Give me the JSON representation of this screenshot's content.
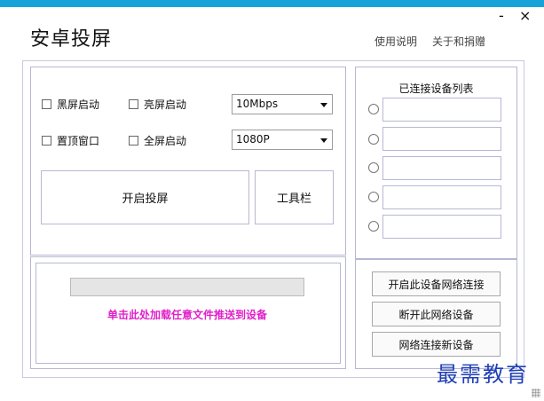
{
  "window": {
    "title": "安卓投屏",
    "minimize_label": "-",
    "close_label": "×"
  },
  "header": {
    "help_link": "使用说明",
    "about_link": "关于和捐赠"
  },
  "options": {
    "black_screen_start": "黑屏启动",
    "bright_screen_start": "亮屏启动",
    "bitrate": "10Mbps",
    "pin_on_top": "置顶窗口",
    "fullscreen_start": "全屏启动",
    "resolution": "1080P"
  },
  "actions": {
    "start_cast": "开启投屏",
    "toolbar": "工具栏"
  },
  "file_push": {
    "hint": "单击此处加载任意文件推送到设备",
    "progress_percent": 0
  },
  "devices": {
    "title": "已连接设备列表",
    "slots": [
      "",
      "",
      "",
      "",
      ""
    ]
  },
  "network": {
    "enable_device_network": "开启此设备网络连接",
    "disconnect_device": "断开此网络设备",
    "connect_new_device": "网络连接新设备"
  },
  "watermark": "最需教育",
  "colors": {
    "accent_bar": "#17a3d9",
    "hint_text": "#e020c9",
    "watermark": "#1f3fb4"
  }
}
